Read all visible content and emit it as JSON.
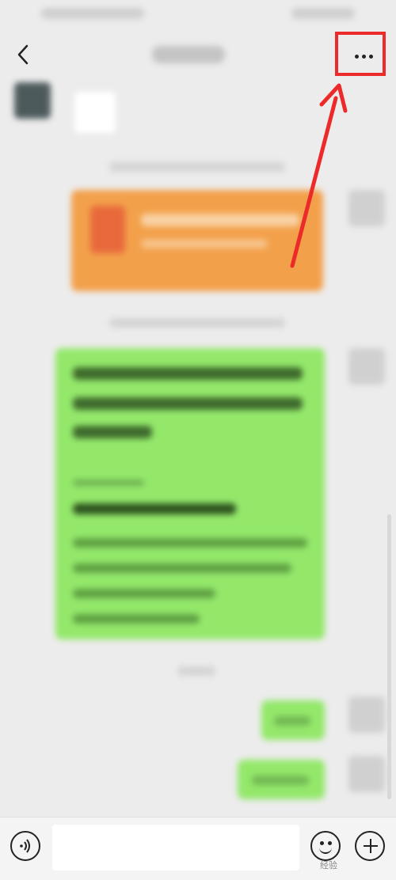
{
  "header": {
    "back_icon": "chevron-left-icon",
    "more_icon": "more-dots-icon"
  },
  "annotations": {
    "highlight_color": "#ec2a2a",
    "arrow_color": "#ec2a2a"
  },
  "colors": {
    "background": "#ececec",
    "received_bubble": "#ffffff",
    "sent_bubble": "#93e86a",
    "card_orange": "#f3a04a"
  },
  "input_bar": {
    "voice_icon": "voice-icon",
    "text_value": "",
    "emoji_icon": "emoji-icon",
    "plus_icon": "plus-icon"
  },
  "watermark": {
    "text": "经验"
  }
}
